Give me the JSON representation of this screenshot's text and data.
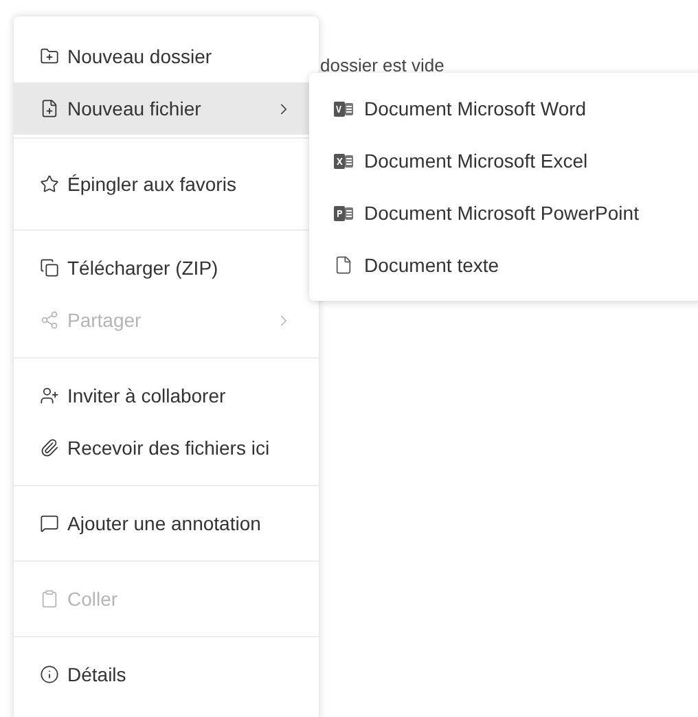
{
  "background_text": "dossier est vide",
  "menu": {
    "groups": [
      [
        {
          "label": "Nouveau dossier",
          "selected": false,
          "disabled": false,
          "has_submenu": false
        },
        {
          "label": "Nouveau fichier",
          "selected": true,
          "disabled": false,
          "has_submenu": true
        }
      ],
      [
        {
          "label": "Épingler aux favoris",
          "selected": false,
          "disabled": false,
          "has_submenu": false
        }
      ],
      [
        {
          "label": "Télécharger (ZIP)",
          "selected": false,
          "disabled": false,
          "has_submenu": false
        },
        {
          "label": "Partager",
          "selected": false,
          "disabled": true,
          "has_submenu": true
        }
      ],
      [
        {
          "label": "Inviter à collaborer",
          "selected": false,
          "disabled": false,
          "has_submenu": false
        },
        {
          "label": "Recevoir des fichiers ici",
          "selected": false,
          "disabled": false,
          "has_submenu": false
        }
      ],
      [
        {
          "label": "Ajouter une annotation",
          "selected": false,
          "disabled": false,
          "has_submenu": false
        }
      ],
      [
        {
          "label": "Coller",
          "selected": false,
          "disabled": true,
          "has_submenu": false
        }
      ],
      [
        {
          "label": "Détails",
          "selected": false,
          "disabled": false,
          "has_submenu": false
        }
      ]
    ]
  },
  "submenu": {
    "items": [
      {
        "label": "Document Microsoft Word"
      },
      {
        "label": "Document Microsoft Excel"
      },
      {
        "label": "Document Microsoft PowerPoint"
      },
      {
        "label": "Document texte"
      }
    ]
  }
}
